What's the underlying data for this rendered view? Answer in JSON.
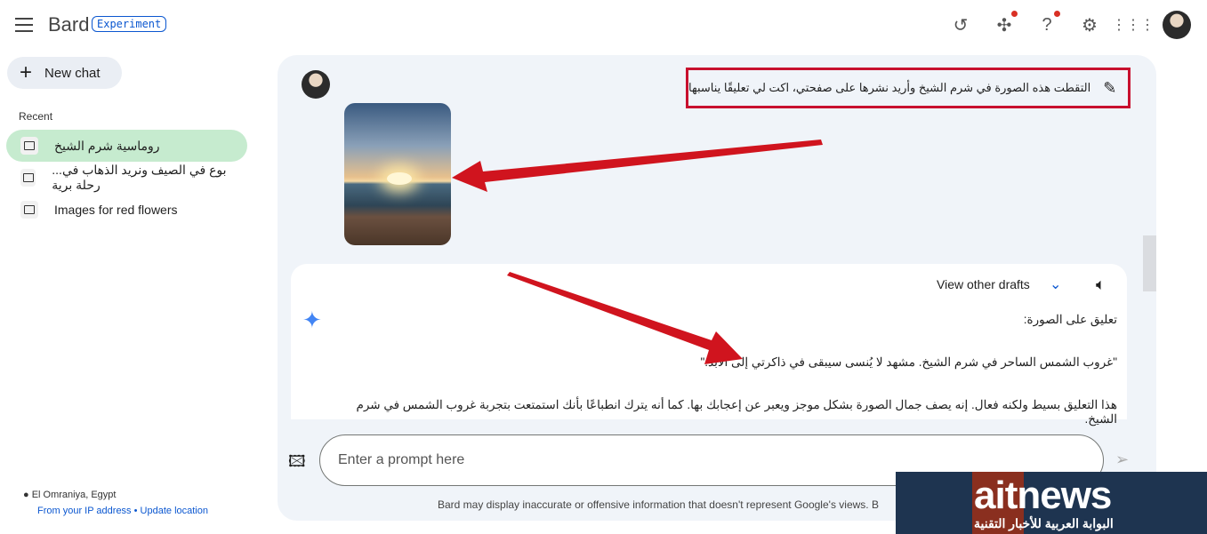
{
  "header": {
    "brand": "Bard",
    "badge": "Experiment",
    "icons": [
      "history-icon",
      "extensions-icon",
      "help-icon",
      "settings-icon",
      "apps-icon",
      "avatar"
    ]
  },
  "sidebar": {
    "new_chat": "New chat",
    "recent_label": "Recent",
    "items": [
      {
        "label": "روماسية شرم الشيخ",
        "active": true
      },
      {
        "label": "...بوع في الصيف ونريد الذهاب في رحلة برية",
        "active": false
      },
      {
        "label": "Images for red flowers",
        "active": false
      }
    ],
    "location": {
      "place": "El Omraniya, Egypt",
      "source": "From your IP address",
      "separator": "•",
      "update": "Update location"
    }
  },
  "chat": {
    "user_prompt": "التقطت هذه الصورة في شرم الشيخ وأريد نشرها على صفحتي، اكت لي تعليقًا يناسبها",
    "response": {
      "view_drafts": "View other drafts",
      "line1": "تعليق على الصورة:",
      "line2": "\"غروب الشمس الساحر في شرم الشيخ. مشهد لا يُنسى سيبقى في ذاكرتي إلى الأبد.\"",
      "line3": "هذا التعليق بسيط ولكنه فعال. إنه يصف جمال الصورة بشكل موجز ويعبر عن إعجابك بها. كما أنه يترك انطباعًا بأنك استمتعت بتجربة غروب الشمس في شرم الشيخ."
    }
  },
  "input": {
    "placeholder": "Enter a prompt here"
  },
  "disclaimer": "Bard may display inaccurate or offensive information that doesn't represent Google's views. B",
  "watermark": {
    "logo": "aitnews",
    "tagline": "البوابة العربية للأخبار التقنية"
  },
  "colors": {
    "accent": "#0b57d0",
    "active_item": "#c6ebcf",
    "annotation": "#c8102e",
    "panel": "#f0f4f9"
  }
}
